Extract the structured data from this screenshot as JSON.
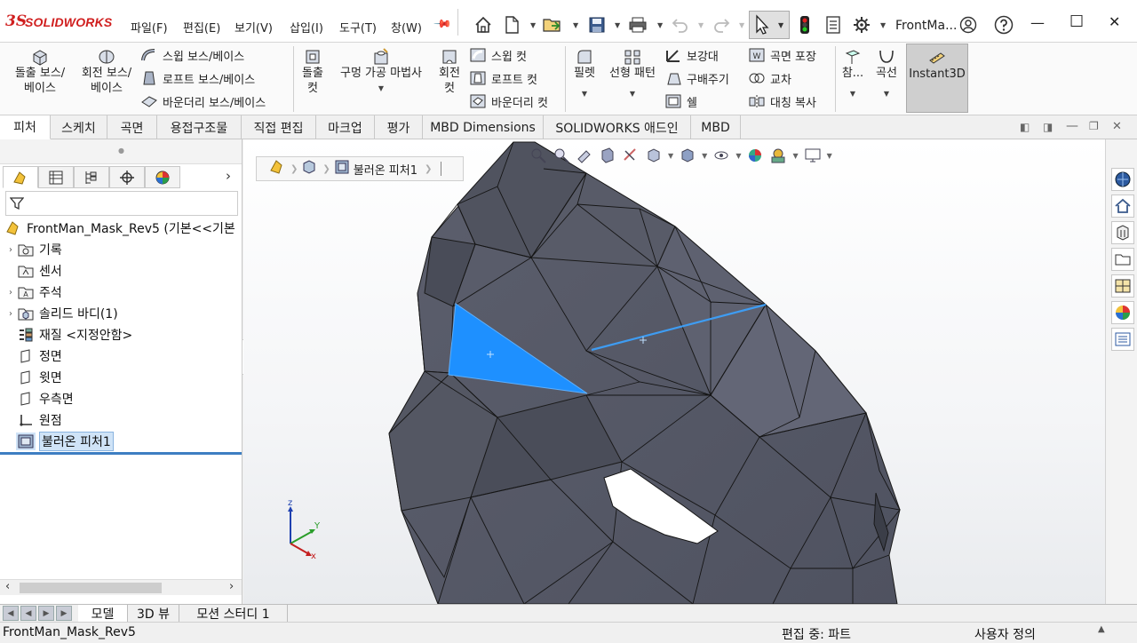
{
  "app": {
    "brand_ds": "3S",
    "brand_name": "SOLIDWORKS",
    "window_title": "FrontMa..."
  },
  "menu": [
    "파일(F)",
    "편집(E)",
    "보기(V)",
    "삽입(I)",
    "도구(T)",
    "창(W)"
  ],
  "icons": {
    "quick_access": [
      "home-icon",
      "new-document-icon",
      "open-folder-icon",
      "save-icon",
      "print-icon",
      "undo-icon",
      "redo-icon",
      "select-cursor-icon",
      "traffic-light-icon",
      "file-properties-icon",
      "options-gear-icon",
      "user-icon",
      "help-icon"
    ]
  },
  "window_controls": {
    "minimize": "—",
    "maximize": "☐",
    "close": "✕"
  },
  "ribbon": {
    "extrude_boss": "돌출 보스/\n베이스",
    "revolve_boss": "회전 보스/\n베이스",
    "sweep_boss": "스윕 보스/베이스",
    "loft_boss": "로프트 보스/베이스",
    "boundary_boss": "바운더리 보스/베이스",
    "extrude_cut": "돌출\n컷",
    "hole_wizard": "구멍 가공 마법사",
    "revolve_cut": "회전\n컷",
    "sweep_cut": "스윕 컷",
    "loft_cut": "로프트 컷",
    "boundary_cut": "바운더리 컷",
    "fillet": "필렛",
    "linear_pattern": "선형 패턴",
    "rib": "보강대",
    "draft": "구배주기",
    "shell": "쉘",
    "wrap": "곡면 포장",
    "intersect": "교차",
    "mirror": "대칭 복사",
    "reference": "참...",
    "curves": "곡선",
    "instant3d": "Instant3D"
  },
  "tabs": [
    "피처",
    "스케치",
    "곡면",
    "용접구조물",
    "직접 편집",
    "마크업",
    "평가",
    "MBD Dimensions",
    "SOLIDWORKS 애드인",
    "MBD"
  ],
  "tree": {
    "root": "FrontMan_Mask_Rev5  (기본<<기본",
    "items": [
      {
        "label": "기록",
        "icon": "history-folder-icon",
        "expand": "›"
      },
      {
        "label": "센서",
        "icon": "sensor-folder-icon",
        "expand": ""
      },
      {
        "label": "주석",
        "icon": "annotations-icon",
        "expand": "›"
      },
      {
        "label": "솔리드 바디(1)",
        "icon": "solid-bodies-icon",
        "expand": "›"
      },
      {
        "label": "재질 <지정안함>",
        "icon": "material-icon",
        "expand": ""
      },
      {
        "label": "정면",
        "icon": "plane-icon",
        "expand": ""
      },
      {
        "label": "윗면",
        "icon": "plane-icon",
        "expand": ""
      },
      {
        "label": "우측면",
        "icon": "plane-icon",
        "expand": ""
      },
      {
        "label": "원점",
        "icon": "origin-icon",
        "expand": ""
      },
      {
        "label": "불러온 피처1",
        "icon": "imported-feature-icon",
        "expand": ""
      }
    ]
  },
  "breadcrumb": {
    "label": "불러온 피처1"
  },
  "triad": {
    "z": "z",
    "y": "Y",
    "x": "x"
  },
  "bottom_tabs": [
    "모델",
    "3D 뷰",
    "모션 스터디 1"
  ],
  "status": {
    "left": "FrontMan_Mask_Rev5",
    "mode": "편집 중: 파트",
    "custom": "사용자 정의"
  },
  "colors": {
    "selection": "#1e90ff",
    "mesh": "#5a5d6b",
    "brand": "#d01f1f"
  }
}
